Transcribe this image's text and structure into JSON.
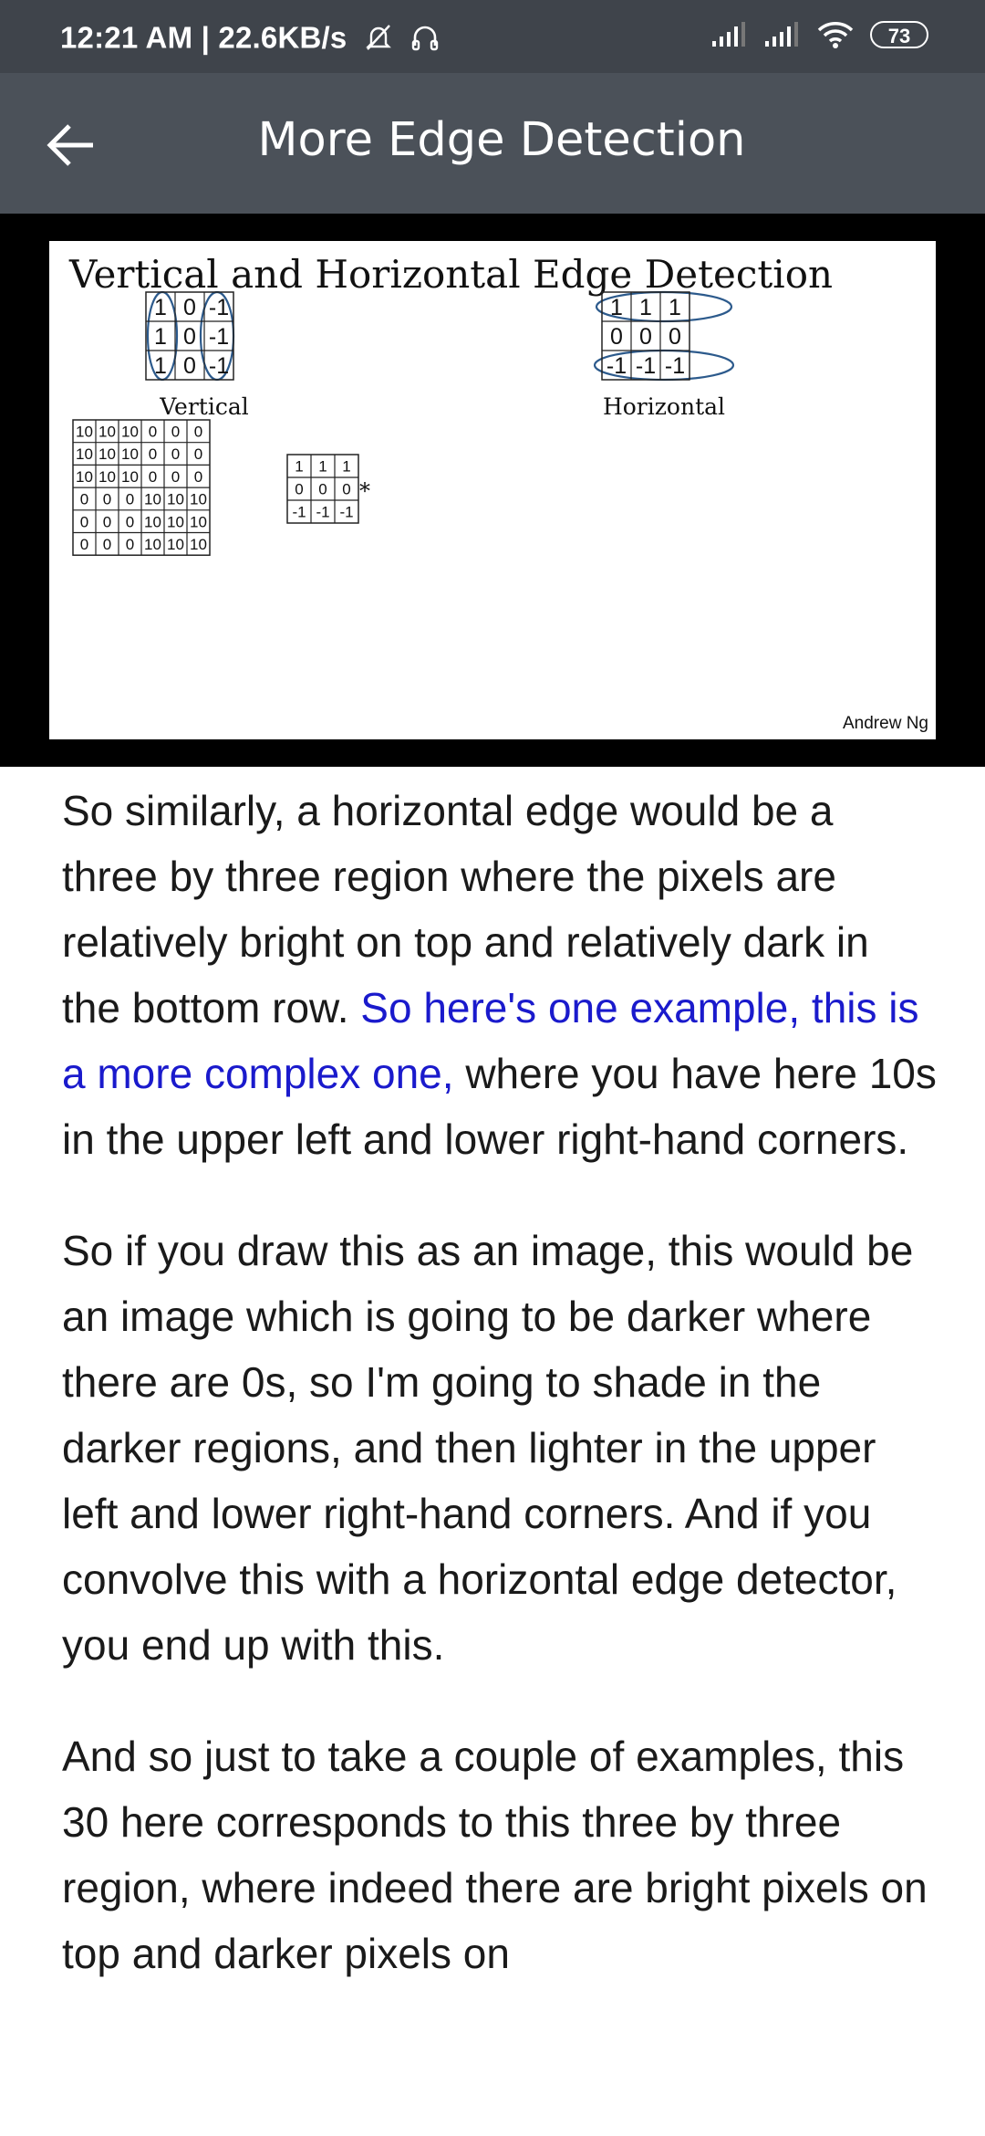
{
  "status_bar": {
    "time_and_speed": "12:21 AM | 22.6KB/s",
    "battery": "73"
  },
  "app_bar": {
    "title": "More Edge Detection"
  },
  "slide": {
    "title": "Vertical and Horizontal Edge Detection",
    "vertical_filter": [
      [
        "1",
        "0",
        "-1"
      ],
      [
        "1",
        "0",
        "-1"
      ],
      [
        "1",
        "0",
        "-1"
      ]
    ],
    "vertical_label": "Vertical",
    "horizontal_filter": [
      [
        "1",
        "1",
        "1"
      ],
      [
        "0",
        "0",
        "0"
      ],
      [
        "-1",
        "-1",
        "-1"
      ]
    ],
    "horizontal_label": "Horizontal",
    "input_image": [
      [
        "10",
        "10",
        "10",
        "0",
        "0",
        "0"
      ],
      [
        "10",
        "10",
        "10",
        "0",
        "0",
        "0"
      ],
      [
        "10",
        "10",
        "10",
        "0",
        "0",
        "0"
      ],
      [
        "0",
        "0",
        "0",
        "10",
        "10",
        "10"
      ],
      [
        "0",
        "0",
        "0",
        "10",
        "10",
        "10"
      ],
      [
        "0",
        "0",
        "0",
        "10",
        "10",
        "10"
      ]
    ],
    "operator": "*",
    "small_filter": [
      [
        "1",
        "1",
        "1"
      ],
      [
        "0",
        "0",
        "0"
      ],
      [
        "-1",
        "-1",
        "-1"
      ]
    ],
    "credit": "Andrew Ng"
  },
  "transcript": {
    "p1_a": "So similarly, a horizontal edge would be a three by three region where the pixels are relatively bright on top and relatively dark in the bottom row. ",
    "p1_highlight": "So here's one example, this is a more complex one,",
    "p1_b": " where you have here 10s in the upper left and lower right-hand corners.",
    "p2": "So if you draw this as an image, this would be an image which is going to be darker where there are 0s, so I'm going to shade in the darker regions, and then lighter in the upper left and lower right-hand corners. And if you convolve this with a horizontal edge detector, you end up with this.",
    "p3": "And so just to take a couple of examples, this 30 here corresponds to this three by three region, where indeed there are bright pixels on top and darker pixels on"
  }
}
